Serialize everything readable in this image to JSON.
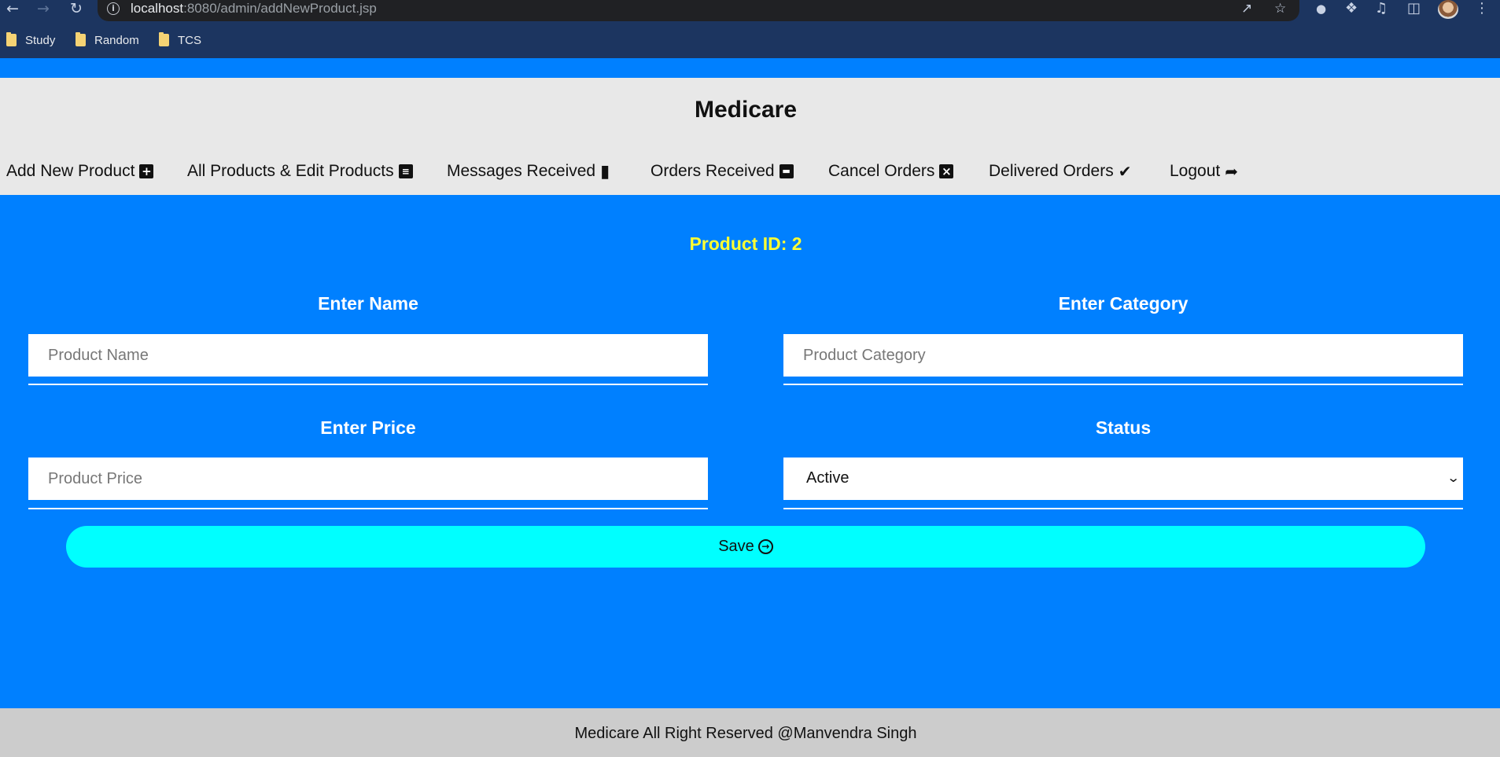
{
  "browser": {
    "url_host": "localhost",
    "url_rest": ":8080/admin/addNewProduct.jsp",
    "bookmarks": [
      {
        "label": "Study"
      },
      {
        "label": "Random"
      },
      {
        "label": "TCS"
      }
    ],
    "icons": [
      "back-arrow-icon",
      "forward-arrow-icon",
      "reload-icon",
      "info-icon",
      "share-icon",
      "star-icon",
      "extension-icon",
      "puzzle-icon",
      "media-icon",
      "sidebar-icon",
      "avatar",
      "more-icon"
    ]
  },
  "header": {
    "site_title": "Medicare",
    "menu": [
      {
        "label": "Add New Product",
        "icon": "plus-square-icon"
      },
      {
        "label": "All Products & Edit Products",
        "icon": "list-icon"
      },
      {
        "label": "Messages Received",
        "icon": "comment-icon"
      },
      {
        "label": "Orders Received",
        "icon": "archive-icon"
      },
      {
        "label": "Cancel Orders",
        "icon": "times-square-icon"
      },
      {
        "label": "Delivered Orders",
        "icon": "dolly-icon"
      },
      {
        "label": "Logout",
        "icon": "share-square-icon"
      }
    ]
  },
  "form": {
    "product_id": "Product ID: 2",
    "name_label": "Enter Name",
    "name_placeholder": "Product Name",
    "category_label": "Enter Category",
    "category_placeholder": "Product Category",
    "price_label": "Enter Price",
    "price_placeholder": "Product Price",
    "status_label": "Status",
    "status_value": "Active",
    "save_label": "Save"
  },
  "footer": {
    "text": "Medicare All Right Reserved @Manvendra Singh"
  },
  "colors": {
    "page_blue": "#0080ff",
    "header_gray": "#e8e8e8",
    "product_id_yellow": "#ffff33",
    "save_cyan": "#00ffff",
    "footer_gray": "#cccccc",
    "browser_frame": "#1c3560"
  }
}
